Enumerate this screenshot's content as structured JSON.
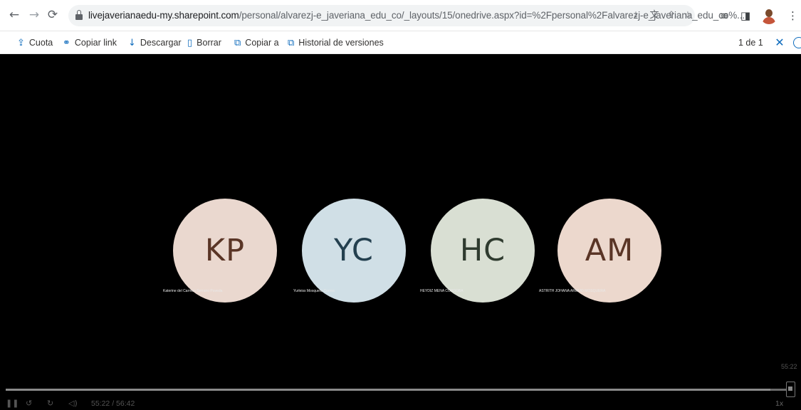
{
  "browser": {
    "url_host": "livejaverianaedu-my.sharepoint.com",
    "url_path": "/personal/alvarezj-e_javeriana_edu_co/_layouts/15/onedrive.aspx?id=%2Fpersonal%2Falvarezj-e_javeriana_edu_co%...",
    "nav_icons": [
      "back-icon",
      "forward-icon",
      "reload-icon"
    ],
    "address_icons": [
      "install-app-icon",
      "translate-icon",
      "share-icon",
      "star-icon"
    ],
    "toolbar_icons": [
      "reading-list-icon",
      "side-panel-icon"
    ]
  },
  "commands": [
    {
      "label": "Cuota",
      "icon": "share-icon"
    },
    {
      "label": "Copiar link",
      "icon": "link-icon"
    },
    {
      "label": "Descargar",
      "icon": "download-icon"
    },
    {
      "label": "Borrar",
      "icon": "trash-icon"
    },
    {
      "label": "Copiar a",
      "icon": "copy-icon"
    },
    {
      "label": "Historial de versiones",
      "icon": "history-icon"
    }
  ],
  "viewer": {
    "counter": "1 de 1"
  },
  "participants": [
    {
      "initials": "KP",
      "name": "Katerine del Carmen Serrano Poveda",
      "bg": "#ead8cf",
      "fg": "#5a3526"
    },
    {
      "initials": "YC",
      "name": "Yurleiss Mosquera Correa",
      "bg": "#d0dfe6",
      "fg": "#24404f"
    },
    {
      "initials": "HC",
      "name": "HEYDIZ MENA CORDOBA",
      "bg": "#d9dfd3",
      "fg": "#2f3b2f"
    },
    {
      "initials": "AM",
      "name": "ASTRITH JOHANA ARMIJO MOSQUERA",
      "bg": "#ecd8cd",
      "fg": "#5a3526"
    }
  ],
  "player": {
    "current_time": "55:22",
    "total_time": "56:42",
    "time_display": "55:22  /  56:42",
    "progress": 0.976,
    "speed": "1x",
    "controls": [
      "play-pause-icon",
      "rewind-10-icon",
      "forward-10-icon",
      "volume-icon"
    ]
  }
}
